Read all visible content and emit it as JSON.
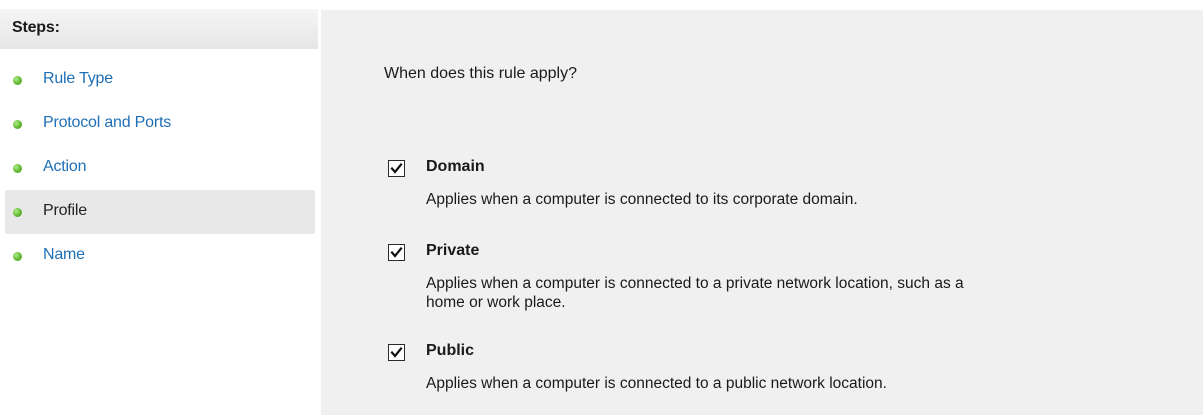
{
  "sidebar": {
    "title": "Steps:",
    "items": [
      {
        "label": "Rule Type",
        "active": false
      },
      {
        "label": "Protocol and Ports",
        "active": false
      },
      {
        "label": "Action",
        "active": false
      },
      {
        "label": "Profile",
        "active": true
      },
      {
        "label": "Name",
        "active": false
      }
    ]
  },
  "main": {
    "question": "When does this rule apply?",
    "options": [
      {
        "label": "Domain",
        "checked": true,
        "description": "Applies when a computer is connected to its corporate domain."
      },
      {
        "label": "Private",
        "checked": true,
        "description": "Applies when a computer is connected to a private network location, such as a home or work place."
      },
      {
        "label": "Public",
        "checked": true,
        "description": "Applies when a computer is connected to a public network location."
      }
    ]
  },
  "colors": {
    "link": "#1f6fb6",
    "panel_bg": "#f0f0f0",
    "active_step_bg": "#e8e8e8",
    "status_dot": "#6cc23e"
  },
  "icons": {
    "step_status": "green-dot-icon",
    "check": "checkmark-icon"
  }
}
